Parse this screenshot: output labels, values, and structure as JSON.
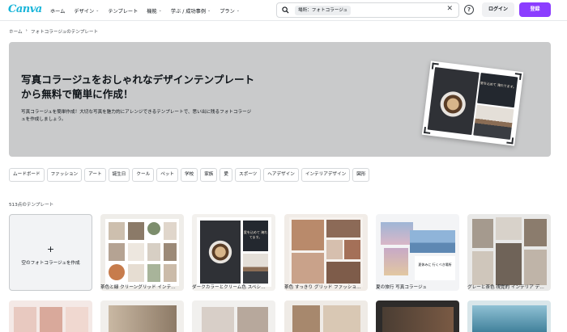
{
  "header": {
    "logo": "Canva",
    "nav": [
      {
        "label": "ホーム",
        "chevron": false
      },
      {
        "label": "デザイン",
        "chevron": true
      },
      {
        "label": "テンプレート",
        "chevron": false
      },
      {
        "label": "機能",
        "chevron": true
      },
      {
        "label": "学ぶ / 成功事例",
        "chevron": true
      },
      {
        "label": "プラン",
        "chevron": true
      }
    ],
    "search_chip": "場所：フォトコラージュ",
    "clear_symbol": "✕",
    "help_symbol": "?",
    "login_label": "ログイン",
    "signup_label": "登録"
  },
  "breadcrumb": {
    "home": "ホーム",
    "separator": "›",
    "current": "フォトコラージュのテンプレート"
  },
  "hero": {
    "title": "写真コラージュをおしゃれなデザインテンプレートから無料で簡単に作成！",
    "description": "写真コラージュを簡単作成！大切な写真を魅力的にアレンジできるテンプレートで、思い出に残るフォトコラージュを作成しましょう。",
    "photo_text": "愛を込めて 淹れてます。"
  },
  "tags": [
    "ムードボード",
    "ファッション",
    "アート",
    "誕生日",
    "クール",
    "ペット",
    "学校",
    "家族",
    "愛",
    "スポーツ",
    "ヘアデザイン",
    "インテリアデザイン",
    "図形"
  ],
  "count_text": "513点のテンプレート",
  "blank_card": {
    "plus": "+",
    "label": "空のフォトコラージュを作成"
  },
  "templates": [
    {
      "title": "茶色と緑 クリーングリッド インテ…"
    },
    {
      "title": "ダークカラーとクリーム色 スペシ…",
      "photo_text": "愛を込めて 淹れてます。"
    },
    {
      "title": "茶色 すっきり グリッド ファッショ…"
    },
    {
      "title": "夏の旅行 写真コラージュ",
      "photo_text": "夏休みに 行くべき場所"
    },
    {
      "title": "グレーと茶色 視覚的 インテリア デ…"
    }
  ],
  "colors": {
    "accent": "#8b3dff",
    "logo": "#19b5d9",
    "hero_bg": "#c9cacb"
  }
}
